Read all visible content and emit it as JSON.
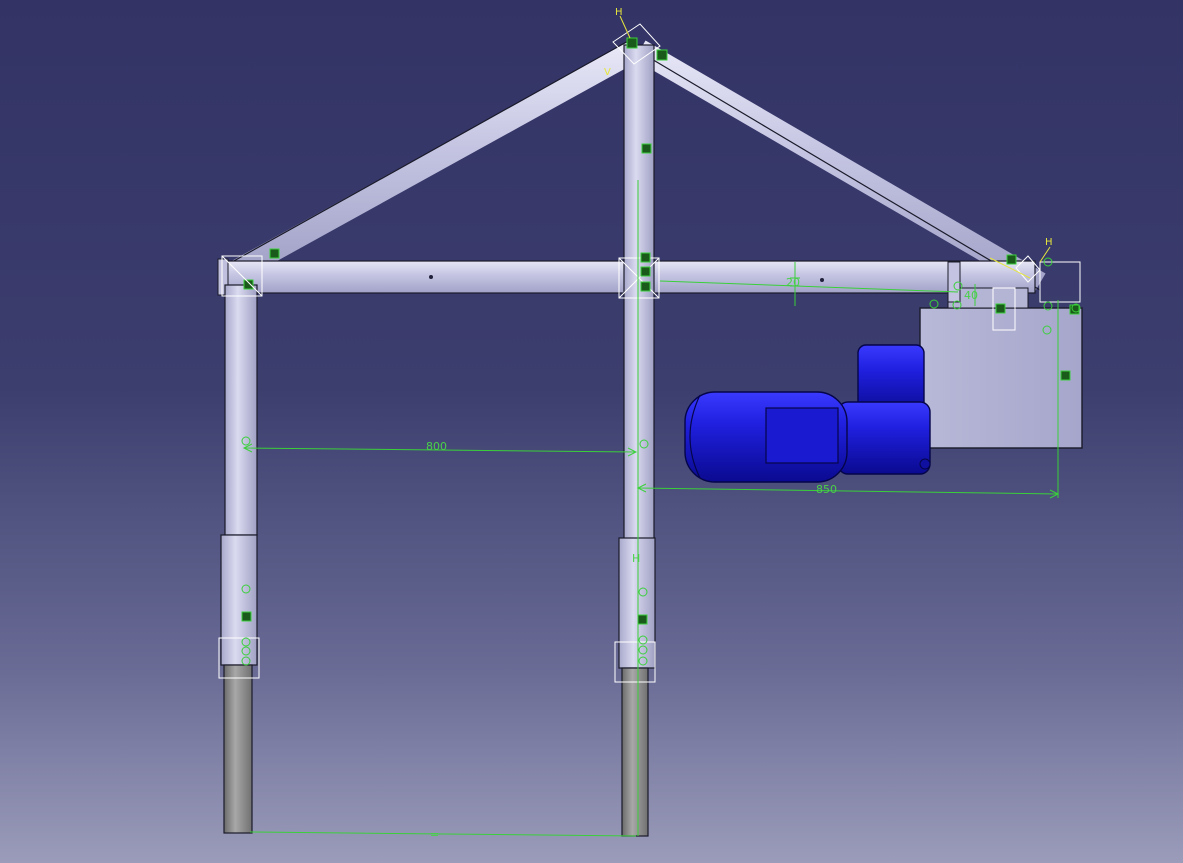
{
  "dimensions": {
    "span_left": "800",
    "span_right": "850",
    "offset_small": "20",
    "offset_motor": "40",
    "bottom_equal": "="
  },
  "constraint_labels": {
    "apex_h": "H",
    "right_h": "H",
    "leg_h": "H",
    "apex_v": "V"
  },
  "colors": {
    "background_top": "#333366",
    "background_bottom": "#9b9cba",
    "tube": "#c8c8e6",
    "motor": "#1414c8",
    "dimension": "#49d149",
    "constraint": "#e6e63c"
  }
}
